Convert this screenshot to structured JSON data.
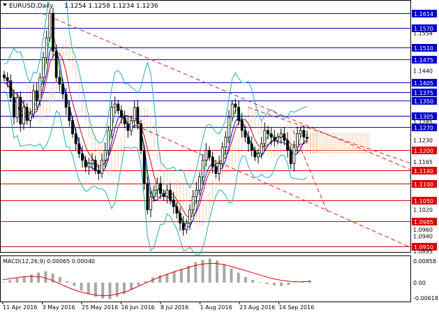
{
  "header": {
    "symbol": "EURUSD,Daily",
    "ohlc": "1.1254 1.1258 1.1234 1.1236"
  },
  "macd": {
    "label": "MACD(12,26,9) 0.00065 0.00040",
    "scale_labels": [
      "0.00858",
      "0.00",
      "-0.00618"
    ]
  },
  "price_scale_labels": [
    "1.1554",
    "1.1440",
    "1.1285",
    "1.1230",
    "1.1165",
    "1.1020",
    "1.0960",
    "1.0940",
    "1.0895"
  ],
  "level_labels": [
    "1.1614",
    "1.1570",
    "1.1510",
    "1.1475",
    "1.1405",
    "1.1375",
    "1.1350",
    "1.1305",
    "1.1270",
    "1.1200",
    "1.1140",
    "1.1100",
    "1.1050",
    "1.0985",
    "1.0910"
  ],
  "date_labels": [
    "11 Apr 2016",
    "3 May 2016",
    "25 May 2016",
    "16 Jun 2016",
    "8 Jul 2016",
    "1 Aug 2016",
    "23 Aug 2016",
    "14 Sep 2016"
  ],
  "colors": {
    "candles": "#000000",
    "horizontal_levels": "#0000cc",
    "red_levels": "#dd0000",
    "trend_lines": "#dd2020",
    "bollinger": "#20b0b0",
    "fast_ma": "#00cc00",
    "slow_ma": "#cc0000",
    "mid_ma": "#0000dd",
    "ichimoku_cloud": "#f0a060",
    "macd_hist": "#a8a8a8",
    "macd_signal": "#dd0000"
  },
  "chart_data": {
    "type": "line",
    "title": "",
    "xlabel": "",
    "ylabel": "",
    "ylim": [
      1.0895,
      1.165
    ],
    "x": [
      "11 Apr 2016",
      "3 May 2016",
      "25 May 2016",
      "16 Jun 2016",
      "8 Jul 2016",
      "1 Aug 2016",
      "23 Aug 2016",
      "14 Sep 2016"
    ],
    "grid": false,
    "legend": "none",
    "series": [
      {
        "values": [
          1.142,
          1.141,
          1.136,
          1.13,
          1.136,
          1.128,
          1.133,
          1.129,
          1.131,
          1.138,
          1.135,
          1.142,
          1.148,
          1.154,
          1.1614,
          1.15,
          1.142,
          1.14,
          1.137,
          1.133,
          1.129,
          1.125,
          1.122,
          1.119,
          1.117,
          1.115,
          1.116,
          1.117,
          1.114,
          1.113,
          1.117,
          1.12,
          1.126,
          1.133,
          1.134,
          1.132,
          1.13,
          1.128,
          1.126,
          1.129,
          1.133,
          1.128,
          1.12,
          1.11,
          1.102,
          1.106,
          1.108,
          1.11,
          1.107,
          1.106,
          1.108,
          1.105,
          1.103,
          1.101,
          1.098,
          1.096,
          1.098,
          1.102,
          1.106,
          1.108,
          1.112,
          1.117,
          1.12,
          1.118,
          1.115,
          1.113,
          1.116,
          1.121,
          1.124,
          1.13,
          1.134,
          1.133,
          1.129,
          1.126,
          1.124,
          1.122,
          1.12,
          1.118,
          1.119,
          1.122,
          1.126,
          1.125,
          1.124,
          1.123,
          1.124,
          1.125,
          1.123,
          1.12,
          1.116,
          1.121,
          1.125,
          1.126,
          1.124,
          1.1236
        ]
      },
      {
        "values": [
          0.0002,
          0.0008,
          0.0015,
          0.0022,
          0.0028,
          0.0035,
          0.004,
          0.0032,
          0.002,
          0.0005,
          -0.0012,
          -0.0028,
          -0.004,
          -0.005,
          -0.0056,
          -0.0058,
          -0.005,
          -0.004,
          -0.0025,
          -0.001,
          0.0005,
          0.0018,
          0.0025,
          0.003,
          0.0038,
          0.0048,
          0.006,
          0.0072,
          0.008,
          0.0085,
          0.0078,
          0.0065,
          0.005,
          0.0035,
          0.002,
          0.001,
          0.0002,
          -0.0005,
          -0.001,
          -0.0012,
          -0.0008,
          -0.0002,
          0.0004,
          0.0008
        ]
      },
      {
        "values": [
          0.001,
          0.0015,
          0.002,
          0.0022,
          0.002,
          0.001,
          -0.0005,
          -0.002,
          -0.0032,
          -0.004,
          -0.0045,
          -0.0046,
          -0.004,
          -0.003,
          -0.0015,
          0.0,
          0.0015,
          0.0028,
          0.004,
          0.005,
          0.006,
          0.0066,
          0.0068,
          0.0064,
          0.0055,
          0.0045,
          0.0035,
          0.0025,
          0.0015,
          0.0008,
          0.0004,
          0.0003,
          0.0004
        ]
      }
    ]
  }
}
